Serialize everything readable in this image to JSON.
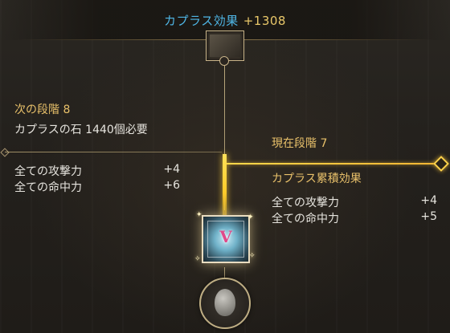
{
  "header": {
    "title": "カプラス効果",
    "value": "+1308"
  },
  "next_stage": {
    "title": "次の段階 8",
    "requirement": "カプラスの石 1440個必要",
    "stats": [
      {
        "label": "全ての攻撃力",
        "value": "+4"
      },
      {
        "label": "全ての命中力",
        "value": "+6"
      }
    ]
  },
  "current_stage": {
    "title": "現在段階 7",
    "section": "カプラス累積効果",
    "stats": [
      {
        "label": "全ての攻撃力",
        "value": "+4"
      },
      {
        "label": "全ての命中力",
        "value": "+5"
      }
    ]
  },
  "icons": {
    "top_node": "kapras-node-icon",
    "main_node": "kapras-current-node-icon",
    "stone": "kapras-stone-icon"
  },
  "colors": {
    "title_blue": "#4fb6e6",
    "gold": "#e8c06a",
    "highlight": "#ffd84a"
  }
}
